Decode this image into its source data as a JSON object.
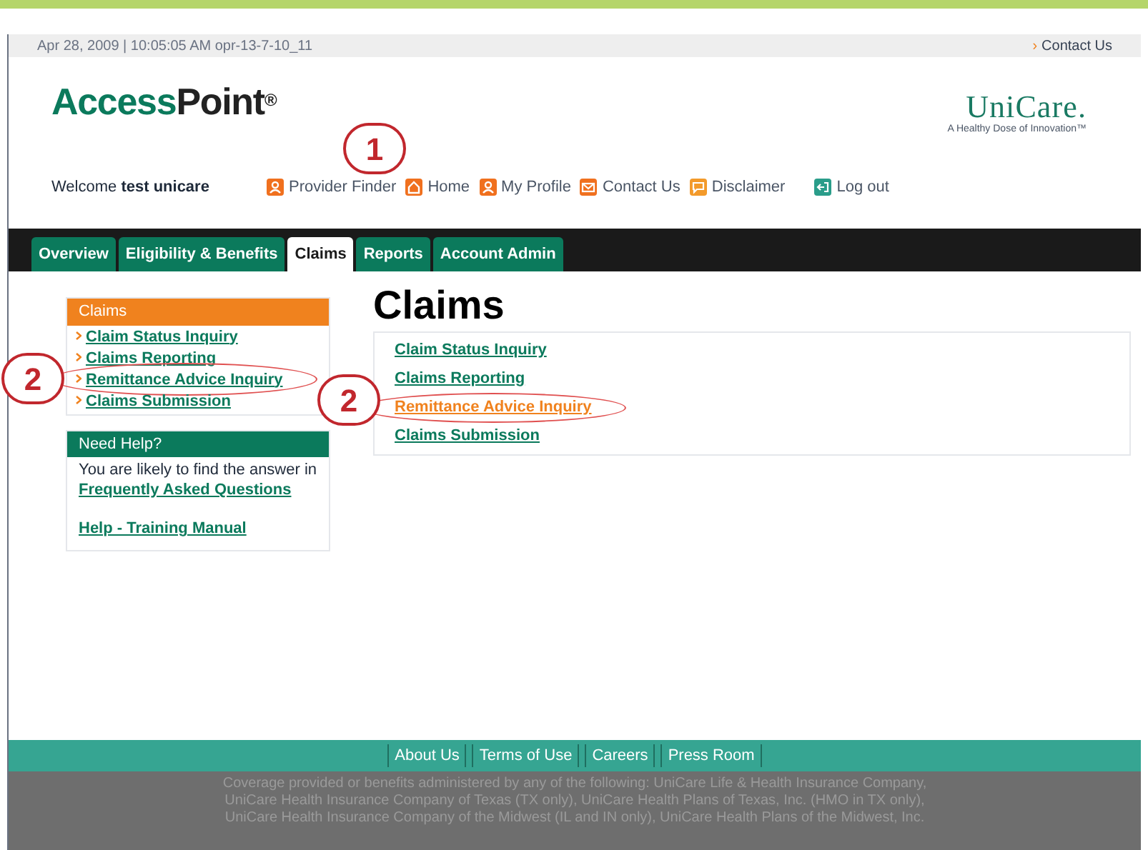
{
  "top_bar": {
    "timestamp": "Apr 28, 2009 | 10:05:05 AM opr-13-7-10_11",
    "contact_marker": "›",
    "contact_link": "Contact Us"
  },
  "header": {
    "logo_bold": "Access",
    "logo_rest": "Point",
    "logo_mark": "®",
    "brand": "UniCare",
    "brand_mark": ".",
    "tagline": "A Healthy Dose of Innovation™"
  },
  "welcome": {
    "prefix": "Welcome",
    "user": "test unicare"
  },
  "util_links": [
    {
      "label": "Provider Finder",
      "kind": "person"
    },
    {
      "label": "Home",
      "kind": "home"
    },
    {
      "label": "My Profile",
      "kind": "person"
    },
    {
      "label": "Contact Us",
      "kind": "mail"
    },
    {
      "label": "Disclaimer",
      "kind": "chat"
    },
    {
      "label": "Log out",
      "kind": "logout"
    }
  ],
  "tabs": [
    {
      "label": "Overview",
      "selected": false
    },
    {
      "label": "Eligibility & Benefits",
      "selected": false
    },
    {
      "label": "Claims",
      "selected": true
    },
    {
      "label": "Reports",
      "selected": false
    },
    {
      "label": "Account Admin",
      "selected": false
    }
  ],
  "sidebar": {
    "title": "Claims",
    "items": [
      {
        "label": "Claim Status Inquiry",
        "circled": false
      },
      {
        "label": "Claims Reporting",
        "circled": false
      },
      {
        "label": "Remittance Advice Inquiry",
        "circled": true
      },
      {
        "label": "Claims Submission",
        "circled": false
      }
    ]
  },
  "help": {
    "title": "Need Help?",
    "text": "You are likely to find the answer in",
    "faq_link": "Frequently Asked Questions",
    "manual_link": "Help - Training Manual"
  },
  "main": {
    "title": "Claims",
    "links": [
      {
        "label": "Claim Status Inquiry",
        "highlighted": false,
        "circled": false
      },
      {
        "label": "Claims Reporting",
        "highlighted": false,
        "circled": false
      },
      {
        "label": "Remittance Advice Inquiry",
        "highlighted": true,
        "circled": true
      },
      {
        "label": "Claims Submission",
        "highlighted": false,
        "circled": false
      }
    ]
  },
  "footer": {
    "links": [
      "About Us",
      "Terms of Use",
      "Careers",
      "Press Room"
    ],
    "lines": [
      "Coverage provided or benefits administered by any of the following: UniCare Life & Health Insurance Company,",
      "UniCare Health Insurance Company of Texas (TX only), UniCare Health Plans of Texas, Inc. (HMO in TX only),",
      "UniCare Health Insurance Company of the Midwest (IL and IN only), UniCare Health Plans of the Midwest, Inc."
    ]
  },
  "annotations": [
    {
      "label": "1"
    },
    {
      "label": "2"
    },
    {
      "label": "2"
    }
  ]
}
